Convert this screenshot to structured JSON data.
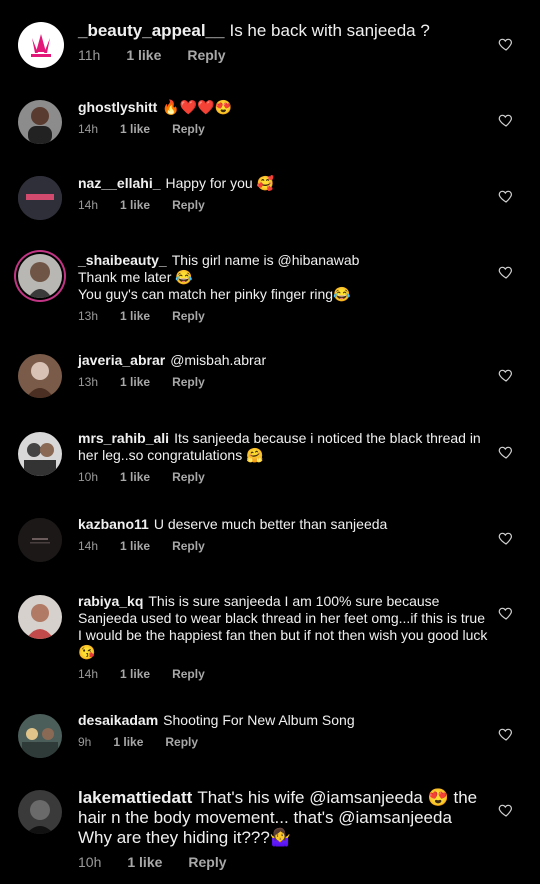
{
  "comments": [
    {
      "user": "_beauty_appeal__",
      "text": "Is he back with sanjeeda ?",
      "time": "11h",
      "likes": "1 like",
      "reply": "Reply",
      "avatar_color": "#ffffff",
      "accent": "#e3177a"
    },
    {
      "user": "ghostlyshitt",
      "text": "🔥❤️❤️😍",
      "time": "14h",
      "likes": "1 like",
      "reply": "Reply",
      "avatar_color": "#8c8c8c",
      "accent": "#4a2f2a"
    },
    {
      "user": "naz__ellahi_",
      "text": "Happy for you 🥰",
      "time": "14h",
      "likes": "1 like",
      "reply": "Reply",
      "avatar_color": "#3a3a46",
      "accent": "#d24a6d"
    },
    {
      "user": "_shaibeauty_",
      "text": "This girl name is @hibanawab\nThank me later 😂\nYou guy's can match her pinky finger ring😂",
      "time": "13h",
      "likes": "1 like",
      "reply": "Reply",
      "avatar_color": "#b9b7b3",
      "accent": "#3a3a3a"
    },
    {
      "user": "javeria_abrar",
      "text": "@misbah.abrar",
      "time": "13h",
      "likes": "1 like",
      "reply": "Reply",
      "avatar_color": "#7a5b49",
      "accent": "#d8c2b5"
    },
    {
      "user": "mrs_rahib_ali",
      "text": "Its sanjeeda because i noticed the black thread in her leg..so congratulations 🤗",
      "time": "10h",
      "likes": "1 like",
      "reply": "Reply",
      "avatar_color": "#d8d8d8",
      "accent": "#444"
    },
    {
      "user": "kazbano11",
      "text": "U deserve much better than sanjeeda",
      "time": "14h",
      "likes": "1 like",
      "reply": "Reply",
      "avatar_color": "#1a1616",
      "accent": "#6b5b5b"
    },
    {
      "user": "rabiya_kq",
      "text": "This is sure sanjeeda I am 100% sure because Sanjeeda used to wear black thread in her feet omg...if this is true I would be the happiest fan then but if not then wish you good luck 😘",
      "time": "14h",
      "likes": "1 like",
      "reply": "Reply",
      "avatar_color": "#d6d1cc",
      "accent": "#c24a4a"
    },
    {
      "user": "desaikadam",
      "text": "Shooting For New Album Song",
      "time": "9h",
      "likes": "1 like",
      "reply": "Reply",
      "avatar_color": "#4b5e5a",
      "accent": "#e0c48a"
    },
    {
      "user": "lakemattiedatt",
      "text": "That's his wife @iamsanjeeda 😍 the hair n the body movement... that's @iamsanjeeda Why are they hiding it???🤷‍♀️",
      "time": "10h",
      "likes": "1 like",
      "reply": "Reply",
      "avatar_color": "#3a3a3a",
      "accent": "#111"
    }
  ],
  "colors": {
    "background": "#000000",
    "text": "#f0f0f0",
    "meta": "#9a9a9a",
    "heart": "#cfcfcf"
  },
  "icons": {
    "like": "heart-outline-icon"
  }
}
